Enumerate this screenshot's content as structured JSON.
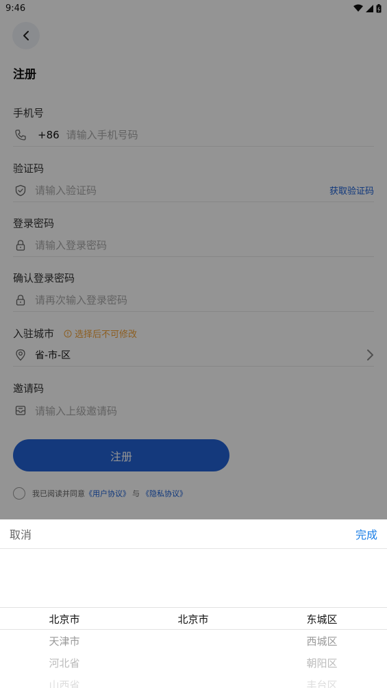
{
  "status_bar": {
    "time": "9:46"
  },
  "header": {
    "title": "注册"
  },
  "form": {
    "phone": {
      "label": "手机号",
      "prefix": "+86",
      "placeholder": "请输入手机号码"
    },
    "code": {
      "label": "验证码",
      "placeholder": "请输入验证码",
      "action": "获取验证码"
    },
    "password": {
      "label": "登录密码",
      "placeholder": "请输入登录密码"
    },
    "confirm": {
      "label": "确认登录密码",
      "placeholder": "请再次输入登录密码"
    },
    "city": {
      "label": "入驻城市",
      "warning": "选择后不可修改",
      "value": "省-市-区"
    },
    "invite": {
      "label": "邀请码",
      "placeholder": "请输入上级邀请码"
    },
    "submit_label": "注册",
    "agreement": {
      "prefix": "我已阅读并同意",
      "user_link": "《用户协议》",
      "and": "与",
      "privacy_link": "《隐私协议》"
    }
  },
  "picker": {
    "cancel": "取消",
    "done": "完成",
    "provinces": [
      "北京市",
      "天津市",
      "河北省",
      "山西省"
    ],
    "cities": [
      "北京市"
    ],
    "districts": [
      "东城区",
      "西城区",
      "朝阳区",
      "丰台区"
    ]
  },
  "colors": {
    "accent": "#2463d6",
    "link": "#1a5fd6",
    "warning": "#f2a33a",
    "done": "#1a7ee6"
  }
}
